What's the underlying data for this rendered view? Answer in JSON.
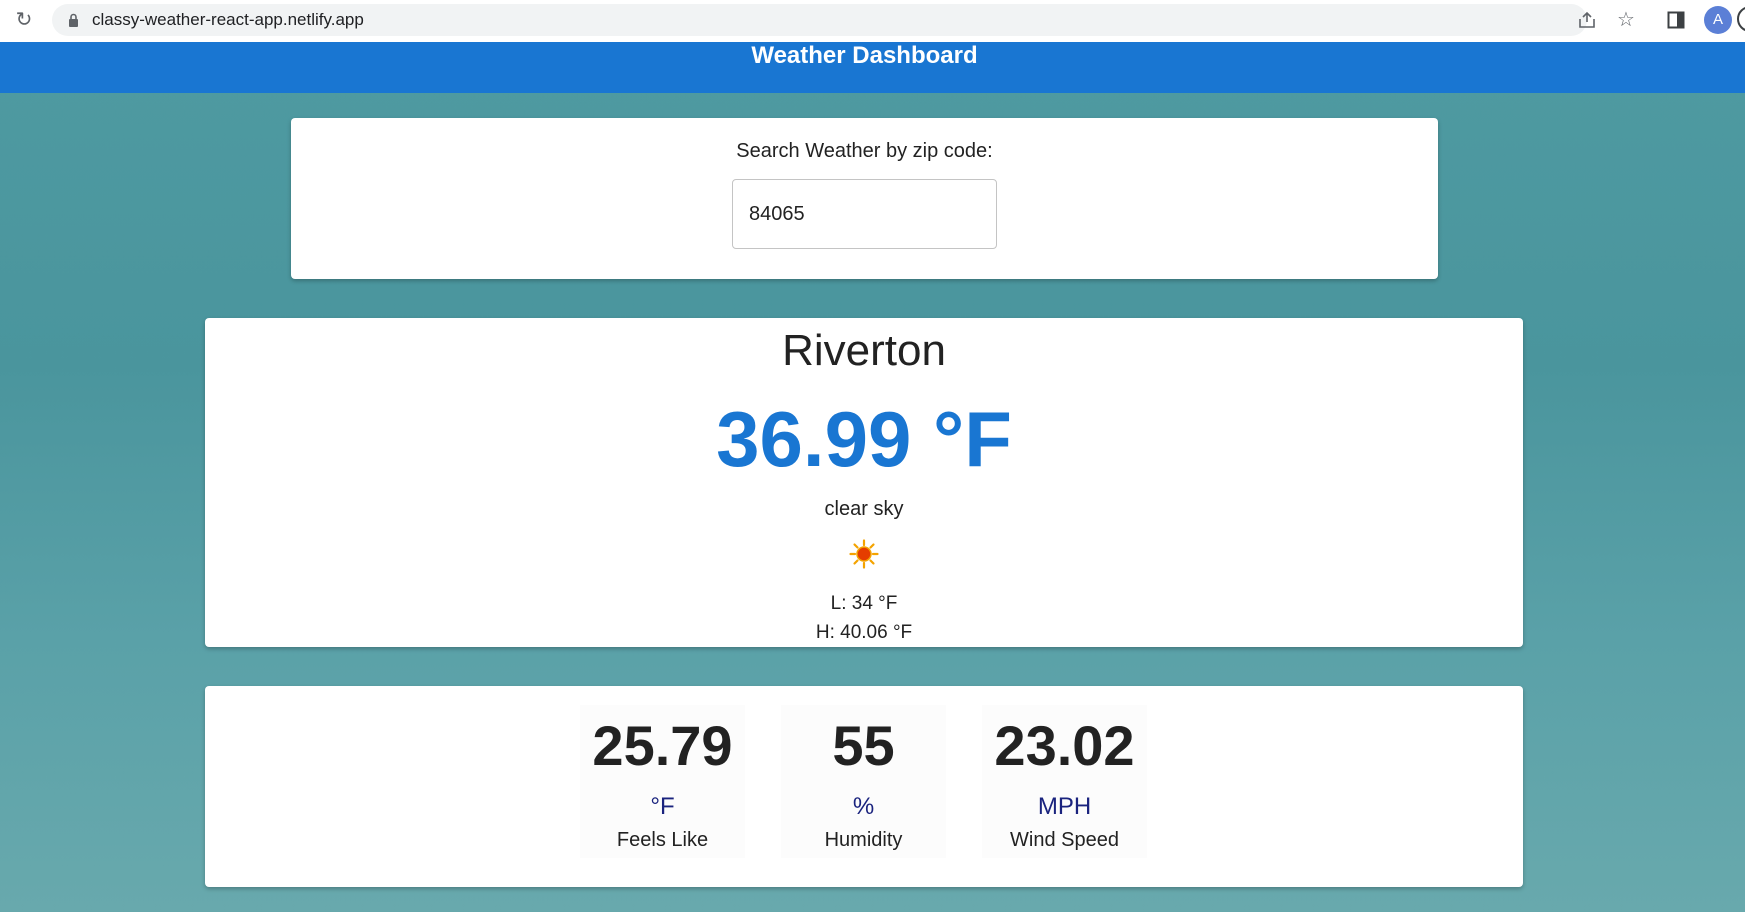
{
  "browser": {
    "url": "classy-weather-react-app.netlify.app",
    "avatar_initial": "A"
  },
  "header": {
    "title": "Weather Dashboard"
  },
  "search": {
    "label": "Search Weather by zip code:",
    "zip_value": "84065"
  },
  "current": {
    "city": "Riverton",
    "temperature": "36.99 °F",
    "description": "clear sky",
    "low": "L: 34 °F",
    "high": "H: 40.06 °F"
  },
  "stats": [
    {
      "value": "25.79",
      "unit": "°F",
      "label": "Feels Like"
    },
    {
      "value": "55",
      "unit": "%",
      "label": "Humidity"
    },
    {
      "value": "23.02",
      "unit": "MPH",
      "label": "Wind Speed"
    }
  ],
  "colors": {
    "accent": "#1976d2",
    "unit_text": "#1a237e"
  },
  "icons": {
    "weather": "sun-icon"
  }
}
